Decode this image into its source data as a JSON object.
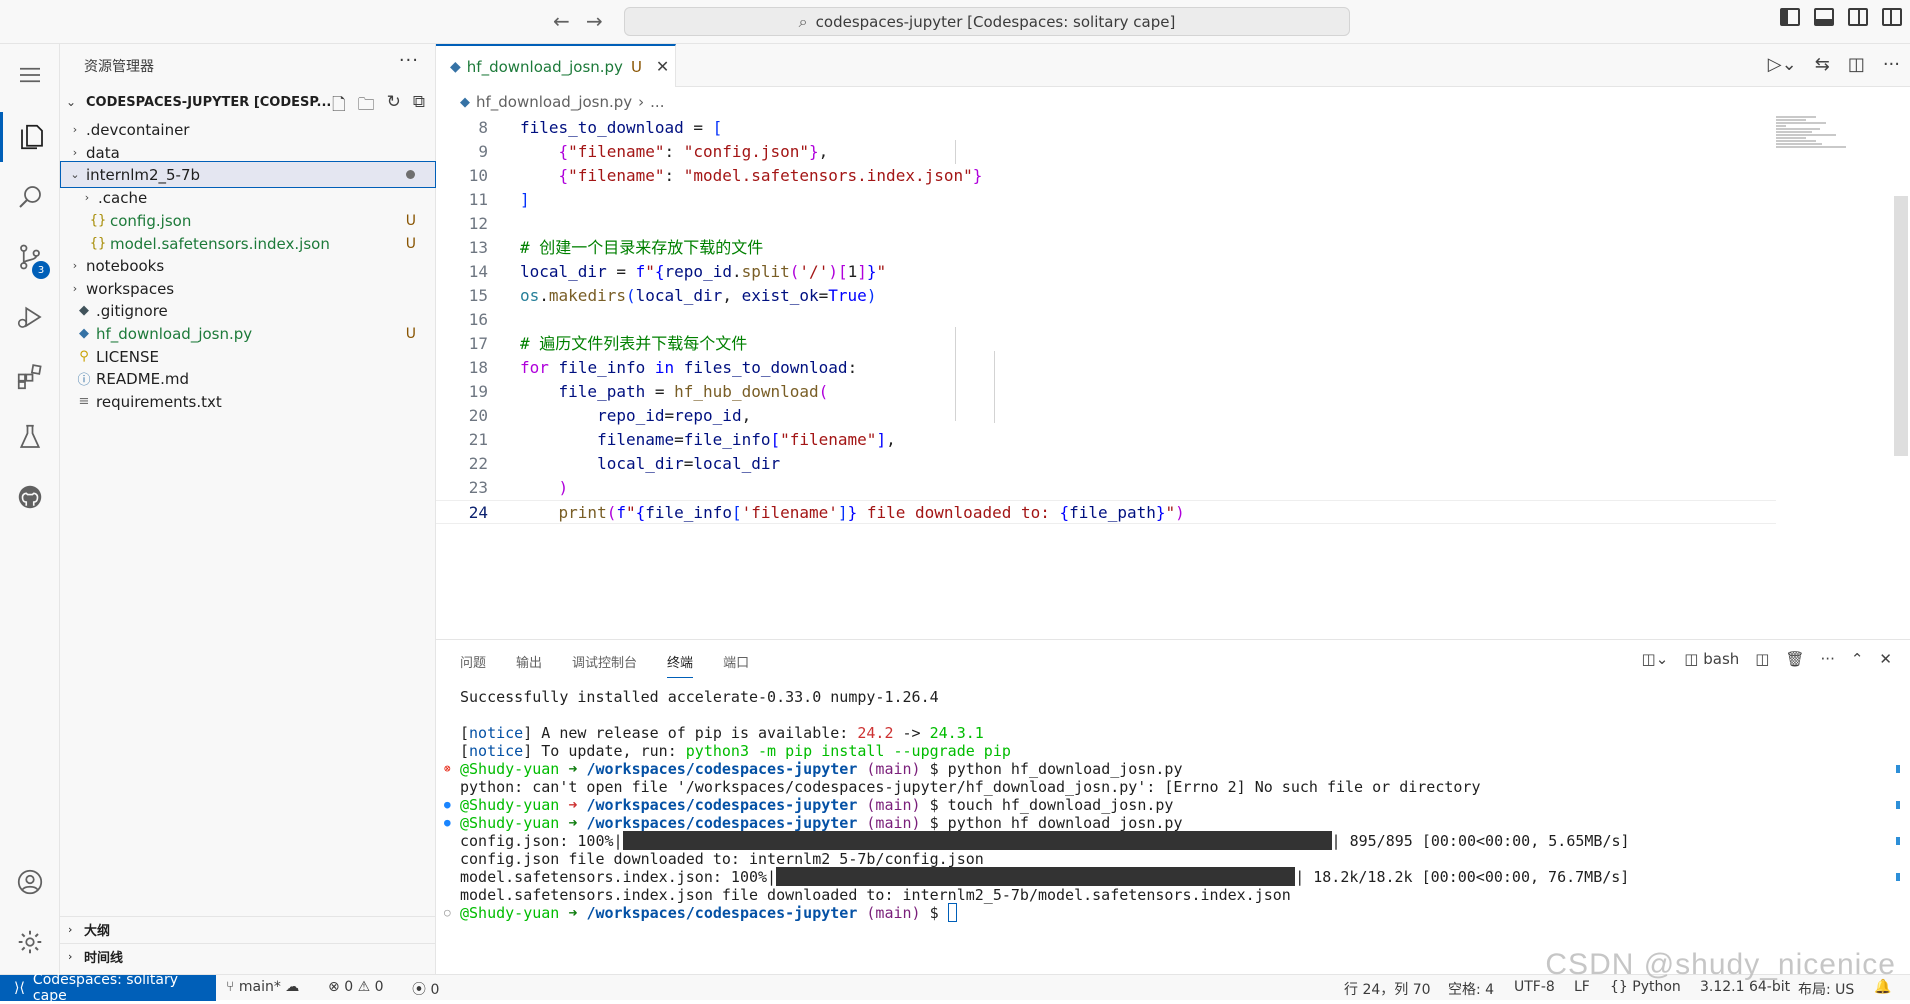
{
  "titlebar": {
    "search_text": "codespaces-jupyter [Codespaces: solitary cape]"
  },
  "activity": {
    "scm_badge": "3"
  },
  "sidebar": {
    "title": "资源管理器",
    "more": "···",
    "section": "CODESPACES-JUPYTER [CODESP...",
    "tree": [
      {
        "label": ".devcontainer",
        "chev": "›",
        "icon": "",
        "status": ""
      },
      {
        "label": "data",
        "chev": "›",
        "icon": "",
        "status": ""
      },
      {
        "label": "internlm2_5-7b",
        "chev": "⌄",
        "icon": "",
        "status": ""
      },
      {
        "label": ".cache",
        "chev": "›",
        "icon": "",
        "status": ""
      },
      {
        "label": "config.json",
        "chev": "",
        "icon": "{}",
        "status": "U"
      },
      {
        "label": "model.safetensors.index.json",
        "chev": "",
        "icon": "{}",
        "status": "U"
      },
      {
        "label": "notebooks",
        "chev": "›",
        "icon": "",
        "status": ""
      },
      {
        "label": "workspaces",
        "chev": "›",
        "icon": "",
        "status": ""
      },
      {
        "label": ".gitignore",
        "chev": "",
        "icon": "◆",
        "status": ""
      },
      {
        "label": "hf_download_josn.py",
        "chev": "",
        "icon": "◆",
        "status": "U"
      },
      {
        "label": "LICENSE",
        "chev": "",
        "icon": "⚲",
        "status": ""
      },
      {
        "label": "README.md",
        "chev": "",
        "icon": "ⓘ",
        "status": ""
      },
      {
        "label": "requirements.txt",
        "chev": "",
        "icon": "≡",
        "status": ""
      }
    ],
    "outline": "大纲",
    "timeline": "时间线"
  },
  "editor": {
    "tab_label": "hf_download_josn.py",
    "tab_status": "U",
    "breadcrumb_file": "hf_download_josn.py",
    "breadcrumb_sep": "›",
    "breadcrumb_more": "...",
    "lines": [
      {
        "n": "8",
        "code": "files_to_download = ["
      },
      {
        "n": "9",
        "code": "    {\"filename\": \"config.json\"},"
      },
      {
        "n": "10",
        "code": "    {\"filename\": \"model.safetensors.index.json\"}"
      },
      {
        "n": "11",
        "code": "]"
      },
      {
        "n": "12",
        "code": ""
      },
      {
        "n": "13",
        "code": "# 创建一个目录来存放下载的文件"
      },
      {
        "n": "14",
        "code": "local_dir = f\"{repo_id.split('/')[1]}\""
      },
      {
        "n": "15",
        "code": "os.makedirs(local_dir, exist_ok=True)"
      },
      {
        "n": "16",
        "code": ""
      },
      {
        "n": "17",
        "code": "# 遍历文件列表并下载每个文件"
      },
      {
        "n": "18",
        "code": "for file_info in files_to_download:"
      },
      {
        "n": "19",
        "code": "    file_path = hf_hub_download("
      },
      {
        "n": "20",
        "code": "        repo_id=repo_id,"
      },
      {
        "n": "21",
        "code": "        filename=file_info[\"filename\"],"
      },
      {
        "n": "22",
        "code": "        local_dir=local_dir"
      },
      {
        "n": "23",
        "code": "    )"
      },
      {
        "n": "24",
        "code": "    print(f\"{file_info['filename']} file downloaded to: {file_path}\")"
      }
    ]
  },
  "panel": {
    "tabs": [
      "问题",
      "输出",
      "调试控制台",
      "终端",
      "端口"
    ],
    "active_tab": "终端",
    "shell": "bash",
    "terminal": {
      "l1": "Successfully installed accelerate-0.33.0 numpy-1.26.4",
      "notice": "notice",
      "l3_text": " A new release of pip is available: ",
      "l3_old": "24.2",
      "l3_arrow": " -> ",
      "l3_new": "24.3.1",
      "l4_text": " To update, run: ",
      "l4_cmd": "python3 -m pip install --upgrade pip",
      "user": "@Shudy-yuan",
      "arrow": " ➜ ",
      "path": "/workspaces/codespaces-jupyter",
      "branch": " (main)",
      "cmd1": " $ python hf_download_josn.py",
      "err": "python: can't open file '/workspaces/codespaces-jupyter/hf_download_josn.py': [Errno 2] No such file or directory",
      "cmd2": " $ touch hf_download_josn.py",
      "cmd3": " $ python hf_download_josn.py",
      "p1_label": "config.json: 100%|",
      "p1_stats": "| 895/895 [00:00<00:00, 5.65MB/s]",
      "p1_progress": 1.0,
      "d1": "config.json file downloaded to: internlm2_5-7b/config.json",
      "p2_label": "model.safetensors.index.json: 100%|",
      "p2_stats": "| 18.2k/18.2k [00:00<00:00, 76.7MB/s]",
      "p2_progress": 1.0,
      "d2": "model.safetensors.index.json file downloaded to: internlm2_5-7b/model.safetensors.index.json",
      "prompt_end": " $ "
    }
  },
  "statusbar": {
    "remote": "Codespaces: solitary cape",
    "branch": "main*",
    "errors": "0",
    "warnings": "0",
    "ports": "0",
    "position": "行 24，列 70",
    "spaces": "空格: 4",
    "encoding": "UTF-8",
    "eol": "LF",
    "language": "Python",
    "interpreter": "3.12.1 64-bit",
    "layout": "布局: US"
  },
  "watermark": "CSDN @shudy_nicenice",
  "colors": {
    "accent": "#005fb8",
    "untracked": "#1d7a3a",
    "modified": "#895503"
  }
}
